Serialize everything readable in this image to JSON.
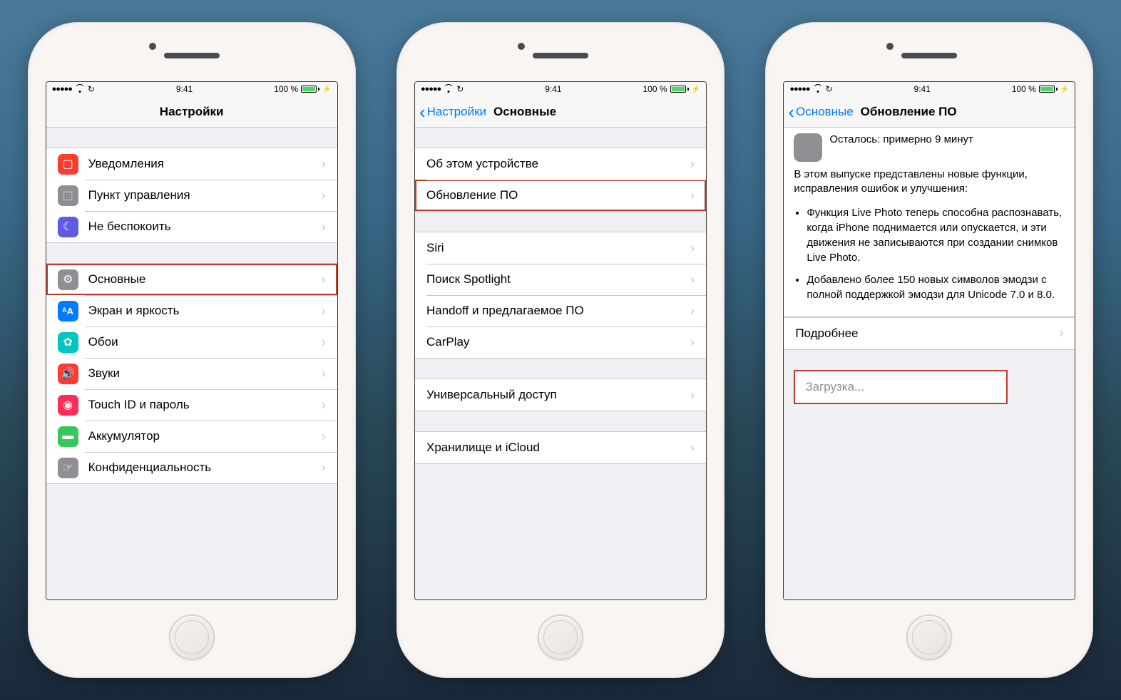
{
  "status": {
    "signal": "●●●●●",
    "wifi": true,
    "refresh": "↻",
    "time": "9:41",
    "battery_pct": "100 %"
  },
  "phone1": {
    "title": "Настройки",
    "group1": [
      {
        "label": "Уведомления",
        "icon": "notif"
      },
      {
        "label": "Пункт управления",
        "icon": "control"
      },
      {
        "label": "Не беспокоить",
        "icon": "dnd"
      }
    ],
    "group2": [
      {
        "label": "Основные",
        "icon": "general",
        "highlight": true
      },
      {
        "label": "Экран и яркость",
        "icon": "display"
      },
      {
        "label": "Обои",
        "icon": "wall"
      },
      {
        "label": "Звуки",
        "icon": "sound"
      },
      {
        "label": "Touch ID и пароль",
        "icon": "touchid"
      },
      {
        "label": "Аккумулятор",
        "icon": "battery"
      },
      {
        "label": "Конфиденциальность",
        "icon": "privacy"
      }
    ]
  },
  "phone2": {
    "back": "Настройки",
    "title": "Основные",
    "group1": [
      {
        "label": "Об этом устройстве"
      },
      {
        "label": "Обновление ПО",
        "highlight": true
      }
    ],
    "group2": [
      {
        "label": "Siri"
      },
      {
        "label": "Поиск Spotlight"
      },
      {
        "label": "Handoff и предлагаемое ПО"
      },
      {
        "label": "CarPlay"
      }
    ],
    "group3": [
      {
        "label": "Универсальный доступ"
      }
    ],
    "group4": [
      {
        "label": "Хранилище и iCloud"
      }
    ]
  },
  "phone3": {
    "back": "Основные",
    "title": "Обновление ПО",
    "remaining": "Осталось: примерно 9 минут",
    "desc": "В этом выпуске представлены новые функции, исправления ошибок и улучшения:",
    "bullets": [
      "Функция Live Photo теперь способна распознавать, когда iPhone поднимается или опускается, и эти движения не записываются при создании снимков Live Photo.",
      "Добавлено более 150 новых символов эмодзи с полной поддержкой эмодзи для Unicode 7.0 и 8.0."
    ],
    "more": "Подробнее",
    "downloading": "Загрузка..."
  },
  "icons": {
    "notif": "▢",
    "control": "⬚",
    "dnd": "☾",
    "general": "⚙",
    "display": "ᴬA",
    "wall": "✿",
    "sound": "🔊",
    "touchid": "◉",
    "battery": "▬",
    "privacy": "☞"
  }
}
